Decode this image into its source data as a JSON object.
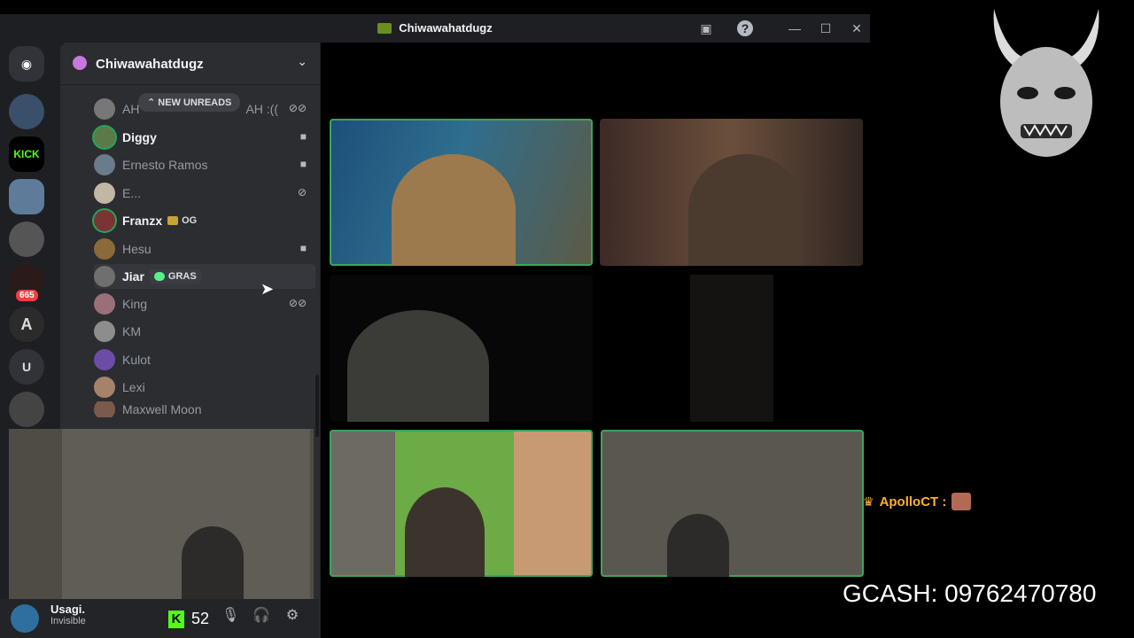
{
  "window": {
    "title": "Chiwawahatdugz"
  },
  "titlebar": {
    "inbox_icon": "▣",
    "help_icon": "?",
    "minimize": "—",
    "maximize": "☐",
    "close": "✕"
  },
  "rail": {
    "home_icon": "◉",
    "servers": [
      {
        "label": ""
      },
      {
        "label": "KICK"
      },
      {
        "label": ""
      },
      {
        "label": ""
      },
      {
        "label": "",
        "badge": "665"
      },
      {
        "label": "A"
      },
      {
        "label": "U"
      },
      {
        "label": ""
      }
    ]
  },
  "server_header": {
    "name": "Chiwawahatdugz",
    "chevron": "⌄"
  },
  "new_unreads": "⌃ NEW UNREADS",
  "members": [
    {
      "name": "AH",
      "tail": "AH :((",
      "icon": "⊘⊘"
    },
    {
      "name": "Diggy",
      "icon": "■"
    },
    {
      "name": "Ernesto Ramos",
      "icon": "■"
    },
    {
      "name": "E...",
      "icon": "⊘"
    },
    {
      "name": "Franzx",
      "tag": "OG"
    },
    {
      "name": "Hesu",
      "icon": "■"
    },
    {
      "name": "Jiar",
      "tag": "GRAS"
    },
    {
      "name": "King",
      "icon": "⊘⊘"
    },
    {
      "name": "KM"
    },
    {
      "name": "Kulot"
    },
    {
      "name": "Lexi"
    },
    {
      "name": "Maxwell Moon"
    }
  ],
  "user_panel": {
    "name": "Usagi.",
    "status": "Invisible",
    "mic_icon": "🎙",
    "headset_icon": "🎧",
    "settings_icon": "⚙"
  },
  "overlay": {
    "chat_user": "ApolloCT :",
    "gcash": "GCASH: 09762470780",
    "kick_count": "52",
    "kick_logo": "K"
  }
}
